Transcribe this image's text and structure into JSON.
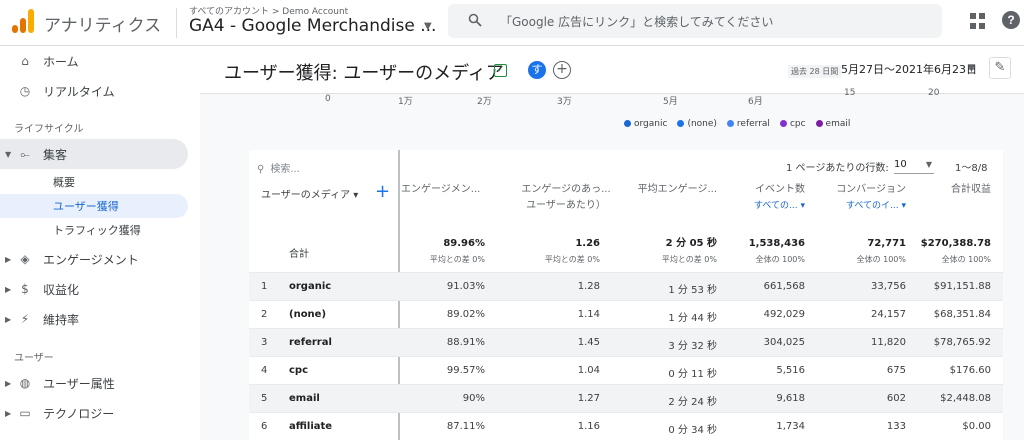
{
  "topbar": {
    "app_title": "アナリティクス",
    "account_crumb": "すべてのアカウント > Demo Account",
    "property_name": "GA4 - Google Merchandise ...",
    "search_placeholder": "「Google 広告にリンク」と検索してみてください",
    "logo_colors": [
      "#f9ab00",
      "#e37400",
      "#e37400"
    ]
  },
  "sidebar": {
    "home": "ホーム",
    "realtime": "リアルタイム",
    "lifecycle_label": "ライフサイクル",
    "acquisition": "集客",
    "acq_overview": "概要",
    "acq_user": "ユーザー獲得",
    "acq_traffic": "トラフィック獲得",
    "engagement": "エンゲージメント",
    "monetization": "収益化",
    "retention": "維持率",
    "user_label": "ユーザー",
    "user_attributes": "ユーザー属性",
    "technology": "テクノロジー"
  },
  "header": {
    "title": "ユーザー獲得: ユーザーのメディア",
    "avatar_initial": "す",
    "date_tag": "過去 28 日間",
    "date_range": "5月27日～2021年6月23日"
  },
  "chart_axis": {
    "labels": [
      "0",
      "1万",
      "2万",
      "3万",
      "5月",
      "6月",
      "15",
      "20"
    ]
  },
  "legend": [
    {
      "name": "organic",
      "color": "#1967d2"
    },
    {
      "name": "(none)",
      "color": "#1a73e8"
    },
    {
      "name": "referral",
      "color": "#4285f4"
    },
    {
      "name": "cpc",
      "color": "#8430ce"
    },
    {
      "name": "email",
      "color": "#7b1fa2"
    }
  ],
  "table": {
    "search_placeholder": "検索...",
    "rows_per_page_label": "1 ページあたりの行数:",
    "rows_per_page_value": "10",
    "pagination": "1〜8/8",
    "dimension_header": "ユーザーのメディア ▾",
    "headers": [
      {
        "line1": "エンゲージメン...",
        "line2": ""
      },
      {
        "line1": "エンゲージのあっ...",
        "line2": "ユーザーあたり）"
      },
      {
        "line1": "平均エンゲージ...",
        "line2": ""
      },
      {
        "line1": "イベント数",
        "line2": "すべての... ▾"
      },
      {
        "line1": "コンバージョン",
        "line2": "すべてのイ... ▾"
      },
      {
        "line1": "合計収益",
        "line2": ""
      }
    ],
    "totals_label": "合計",
    "totals": [
      {
        "value": "89.96%",
        "sub": "平均との差 0%"
      },
      {
        "value": "1.26",
        "sub": "平均との差 0%"
      },
      {
        "value": "2 分 05 秒",
        "sub": "平均との差 0%"
      },
      {
        "value": "1,538,436",
        "sub": "全体の 100%"
      },
      {
        "value": "72,771",
        "sub": "全体の 100%"
      },
      {
        "value": "$270,388.78",
        "sub": "全体の 100%"
      }
    ],
    "rows": [
      {
        "idx": "1",
        "medium": "organic",
        "c": [
          "91.03%",
          "1.28",
          "1 分 53 秒",
          "661,568",
          "33,756",
          "$91,151.88"
        ]
      },
      {
        "idx": "2",
        "medium": "(none)",
        "c": [
          "89.02%",
          "1.14",
          "1 分 44 秒",
          "492,029",
          "24,157",
          "$68,351.84"
        ]
      },
      {
        "idx": "3",
        "medium": "referral",
        "c": [
          "88.91%",
          "1.45",
          "3 分 32 秒",
          "304,025",
          "11,820",
          "$78,765.92"
        ]
      },
      {
        "idx": "4",
        "medium": "cpc",
        "c": [
          "99.57%",
          "1.04",
          "0 分 11 秒",
          "5,516",
          "675",
          "$176.60"
        ]
      },
      {
        "idx": "5",
        "medium": "email",
        "c": [
          "90%",
          "1.27",
          "2 分 24 秒",
          "9,618",
          "602",
          "$2,448.08"
        ]
      },
      {
        "idx": "6",
        "medium": "affiliate",
        "c": [
          "87.11%",
          "1.16",
          "0 分 34 秒",
          "1,734",
          "133",
          "$0.00"
        ]
      }
    ]
  }
}
